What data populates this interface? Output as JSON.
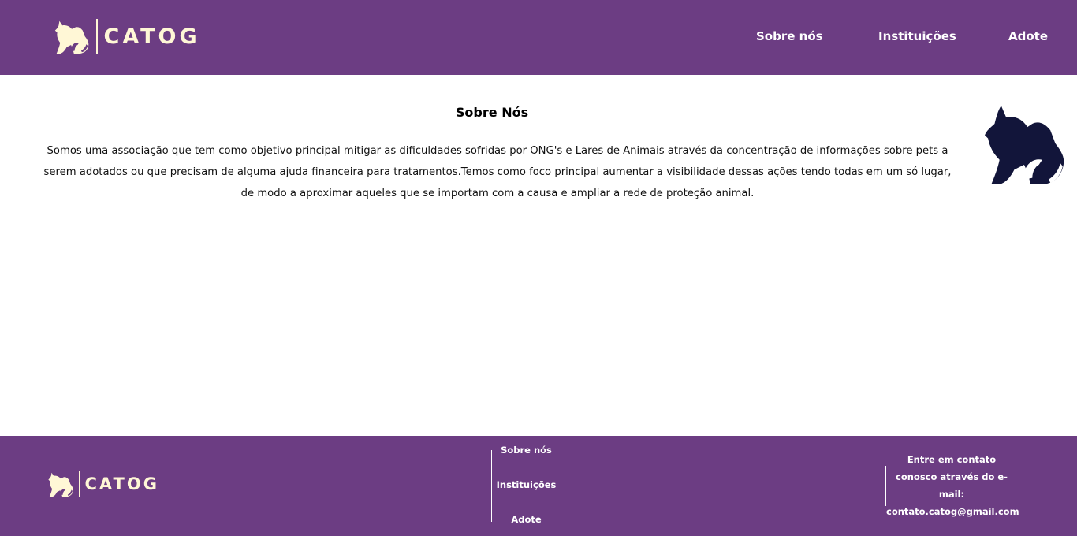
{
  "header": {
    "logo_text": "CATOG",
    "nav": {
      "sobre": "Sobre nós",
      "instituicoes": "Instituições",
      "adote": "Adote"
    }
  },
  "main": {
    "title": "Sobre Nós",
    "text": "Somos uma associação que tem como objetivo principal mitigar as dificuldades sofridas por ONG's e Lares de Animais através da concentração de informações sobre pets a serem adotados ou que precisam de alguma ajuda financeira para tratamentos.Temos como foco principal aumentar a visibilidade dessas ações tendo todas em um só lugar, de modo a aproximar aqueles que se importam com a causa e ampliar a rede de proteção animal.",
    "side_icon": "dog-cat-icon"
  },
  "footer": {
    "logo_text": "CATOG",
    "links": {
      "sobre": "Sobre nós",
      "instituicoes": "Instituições",
      "adote": "Adote"
    },
    "contact_text": "Entre em contato conosco através do e-mail:",
    "contact_email": "contato.catog@gmail.com"
  },
  "colors": {
    "brand_purple": "#6c3d83",
    "logo_cream": "#fff7d6",
    "pet_navy": "#12153a"
  }
}
